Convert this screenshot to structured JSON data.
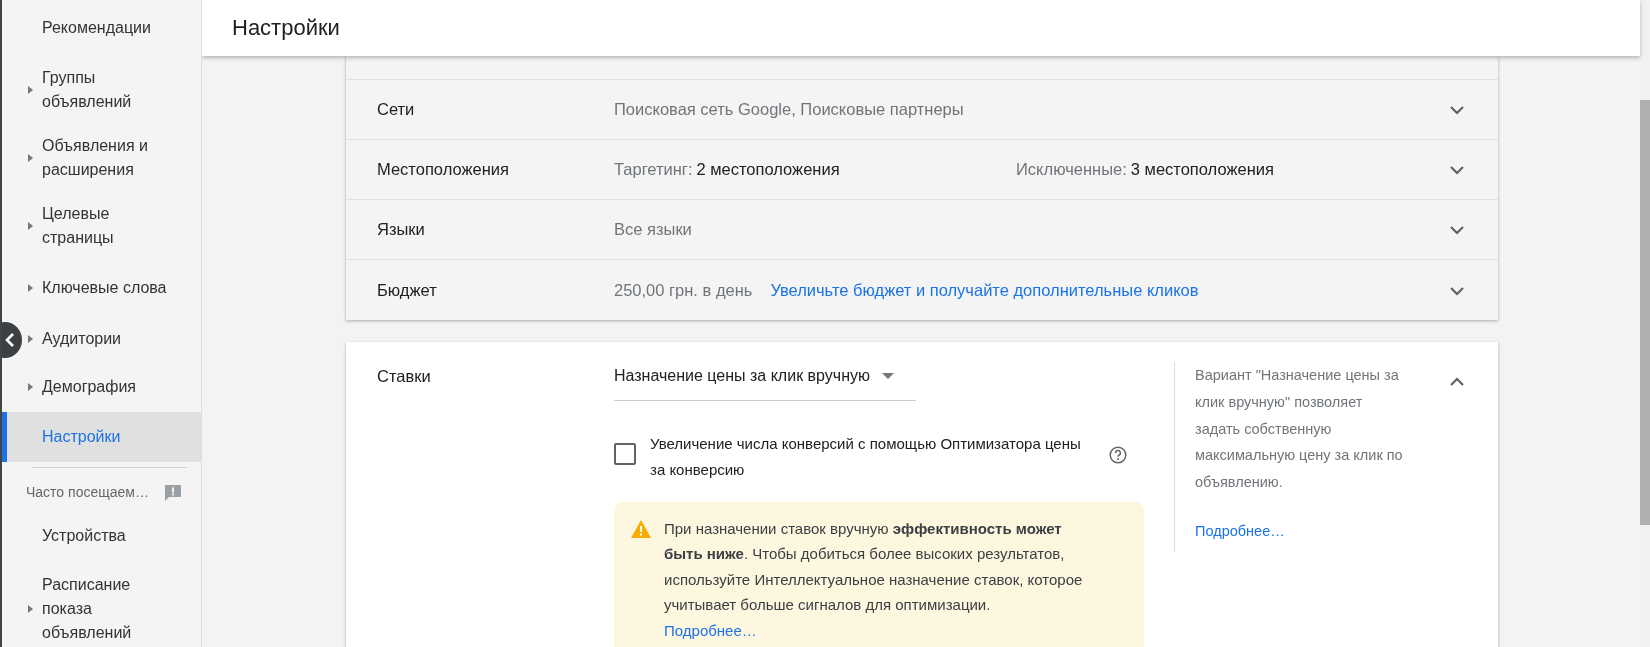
{
  "sidebar": {
    "items": [
      {
        "label": "Рекомендации",
        "expandable": false,
        "selected": false
      },
      {
        "label": "Группы объявлений",
        "expandable": true,
        "selected": false
      },
      {
        "label": "Объявления и расширения",
        "expandable": true,
        "selected": false
      },
      {
        "label": "Целевые страницы",
        "expandable": true,
        "selected": false
      },
      {
        "label": "Ключевые слова",
        "expandable": true,
        "selected": false
      },
      {
        "label": "Аудитории",
        "expandable": true,
        "selected": false
      },
      {
        "label": "Демография",
        "expandable": true,
        "selected": false
      },
      {
        "label": "Настройки",
        "expandable": false,
        "selected": true
      }
    ],
    "section": {
      "label": "Часто посещаем…"
    },
    "section_items": [
      {
        "label": "Устройства",
        "expandable": false,
        "selected": false
      },
      {
        "label": "Расписание показа объявлений",
        "expandable": true,
        "selected": false
      }
    ]
  },
  "header": {
    "title": "Настройки"
  },
  "settings_rows": [
    {
      "label": "Сети",
      "expanded": false,
      "cells": [
        [
          {
            "kind": "muted",
            "text": "Поисковая сеть Google, Поисковые партнеры"
          }
        ]
      ]
    },
    {
      "label": "Местоположения",
      "expanded": false,
      "cells": [
        [
          {
            "kind": "muted",
            "text": "Таргетинг:"
          },
          {
            "kind": "value",
            "text": "2 местоположения"
          }
        ],
        [
          {
            "kind": "muted",
            "text": "Исключенные:"
          },
          {
            "kind": "value",
            "text": "3 местоположения"
          }
        ]
      ]
    },
    {
      "label": "Языки",
      "expanded": false,
      "cells": [
        [
          {
            "kind": "muted",
            "text": "Все языки"
          }
        ]
      ]
    },
    {
      "label": "Бюджет",
      "expanded": false,
      "cells": [
        [
          {
            "kind": "muted",
            "text": "250,00 грн. в день"
          },
          {
            "kind": "link",
            "text": "Увеличьте бюджет и получайте дополнительные кликов"
          }
        ]
      ]
    }
  ],
  "bids": {
    "label": "Ставки",
    "expanded": true,
    "strategy": "Назначение цены за клик вручную",
    "checkbox": {
      "label": "Увеличение числа конверсий с помощью Оптимизатора цены за конверсию",
      "checked": false
    },
    "warning": {
      "text": "При назначении ставок вручную **эффективность может быть ниже**. Чтобы добиться более высоких результатов, используйте Интеллектуальное назначение ставок, которое учитывает больше сигналов для оптимизации.",
      "link": "Подробнее…"
    },
    "info": {
      "text": "Вариант \"Назначение цены за клик вручную\" позволяет задать собственную максимальную цену за клик по объявлению.",
      "link": "Подробнее…"
    }
  }
}
